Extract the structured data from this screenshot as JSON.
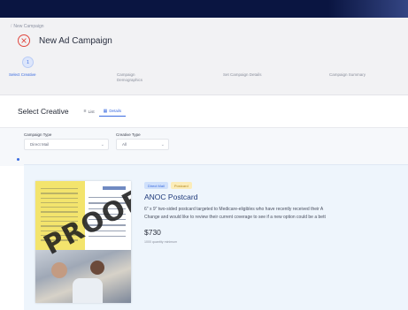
{
  "breadcrumb": {
    "root": "",
    "current": "New Campaign"
  },
  "title": "New Ad Campaign",
  "steps": [
    {
      "badge": "1",
      "label": "Select Creative",
      "label2": ""
    },
    {
      "badge": "",
      "label": "Campaign",
      "label2": "Demographics"
    },
    {
      "badge": "",
      "label": "Set Campaign Details",
      "label2": ""
    },
    {
      "badge": "",
      "label": "Campaign Summary",
      "label2": ""
    }
  ],
  "select": {
    "title": "Select Creative",
    "views": [
      {
        "icon": "list-icon",
        "label": "List"
      },
      {
        "icon": "grid-icon",
        "label": "Details"
      }
    ]
  },
  "filters": {
    "campaign_type": {
      "label": "Campaign Type",
      "value": "Direct Mail"
    },
    "creative_type": {
      "label": "Creative Type",
      "value": "All"
    }
  },
  "product": {
    "tags": [
      "Direct Mail",
      "Postcard"
    ],
    "name": "ANOC Postcard",
    "desc1": "6\" x 9\" two-sided postcard targeted to Medicare-eligibles who have recently received their A",
    "desc2": "Change and would like to review their current coverage to see if a new option could be a bett",
    "price": "$730",
    "min": "1000 quantity minimum",
    "watermark": "PROOF"
  },
  "colors": {
    "topbar": "#0a1541",
    "accent": "#3a6be0",
    "close": "#e0473f",
    "card": "#eef5fc"
  }
}
